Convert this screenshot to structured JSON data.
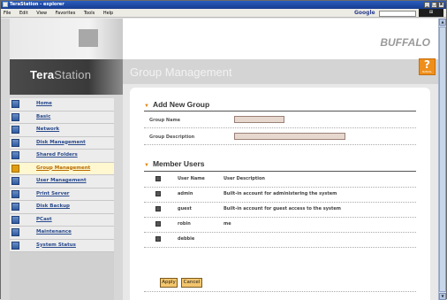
{
  "window": {
    "title": "TeraStation - explorer",
    "btn_min": "_",
    "btn_max": "□",
    "btn_close": "x"
  },
  "menubar": {
    "items": [
      "File",
      "Edit",
      "View",
      "Favorites",
      "Tools",
      "Help"
    ],
    "google_label": "Google"
  },
  "brand": {
    "logo_bold": "Tera",
    "logo_light": "Station",
    "company": "BUFFALO"
  },
  "sidebar": {
    "items": [
      {
        "label": "Home",
        "icon": "home-icon"
      },
      {
        "label": "Basic",
        "icon": "basic-icon"
      },
      {
        "label": "Network",
        "icon": "network-icon"
      },
      {
        "label": "Disk Management",
        "icon": "disk-icon"
      },
      {
        "label": "Shared Folders",
        "icon": "folder-icon"
      },
      {
        "label": "Group Management",
        "icon": "group-icon",
        "active": true
      },
      {
        "label": "User Management",
        "icon": "user-icon"
      },
      {
        "label": "Print Server",
        "icon": "printer-icon"
      },
      {
        "label": "Disk Backup",
        "icon": "backup-icon"
      },
      {
        "label": "PCast",
        "icon": "pcast-icon"
      },
      {
        "label": "Maintenance",
        "icon": "maintenance-icon"
      },
      {
        "label": "System Status",
        "icon": "status-icon"
      }
    ]
  },
  "page": {
    "title": "Group Management",
    "manual_q": "?",
    "manual_label": "MANUAL"
  },
  "add_group": {
    "title": "Add New Group",
    "name_label": "Group Name",
    "desc_label": "Group Description",
    "name_value": "",
    "desc_value": ""
  },
  "members": {
    "title": "Member Users",
    "header": {
      "name": "User Name",
      "desc": "User Description"
    },
    "rows": [
      {
        "name": "admin",
        "desc": "Built-in account for administering the system"
      },
      {
        "name": "guest",
        "desc": "Built-in account for guest access to the system"
      },
      {
        "name": "robin",
        "desc": "me"
      },
      {
        "name": "debbie",
        "desc": ""
      }
    ]
  },
  "buttons": {
    "apply": "Apply",
    "cancel": "Cancel"
  },
  "colors": {
    "accent": "#ef8f1b",
    "link": "#294a8c",
    "input_bg": "#e7d8cf"
  }
}
